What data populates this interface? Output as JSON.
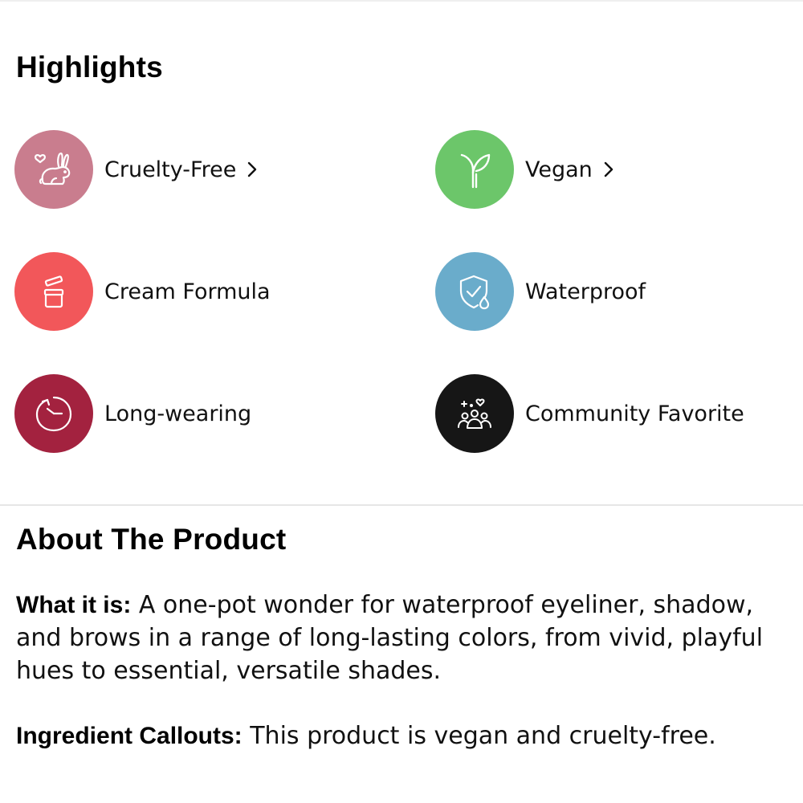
{
  "highlights": {
    "title": "Highlights",
    "items": [
      {
        "label": "Cruelty-Free",
        "icon": "bunny-heart-icon",
        "color": "#c97d8e",
        "has_link": true
      },
      {
        "label": "Vegan",
        "icon": "sprout-icon",
        "color": "#6cc66a",
        "has_link": true
      },
      {
        "label": "Cream Formula",
        "icon": "cream-jar-icon",
        "color": "#f2575a",
        "has_link": false
      },
      {
        "label": "Waterproof",
        "icon": "shield-drop-icon",
        "color": "#6aaccb",
        "has_link": false
      },
      {
        "label": "Long-wearing",
        "icon": "clock-icon",
        "color": "#a3223f",
        "has_link": false
      },
      {
        "label": "Community Favorite",
        "icon": "community-icon",
        "color": "#161616",
        "has_link": false
      }
    ]
  },
  "about": {
    "title": "About The Product",
    "what_it_is": {
      "lead": "What it is:",
      "text": " A one-pot wonder for waterproof eyeliner, shadow, and brows in a range of long-lasting colors, from vivid, playful hues to essential, versatile shades."
    },
    "ingredient_callouts": {
      "lead": "Ingredient Callouts:",
      "text": " This product is vegan and cruelty-free."
    }
  }
}
